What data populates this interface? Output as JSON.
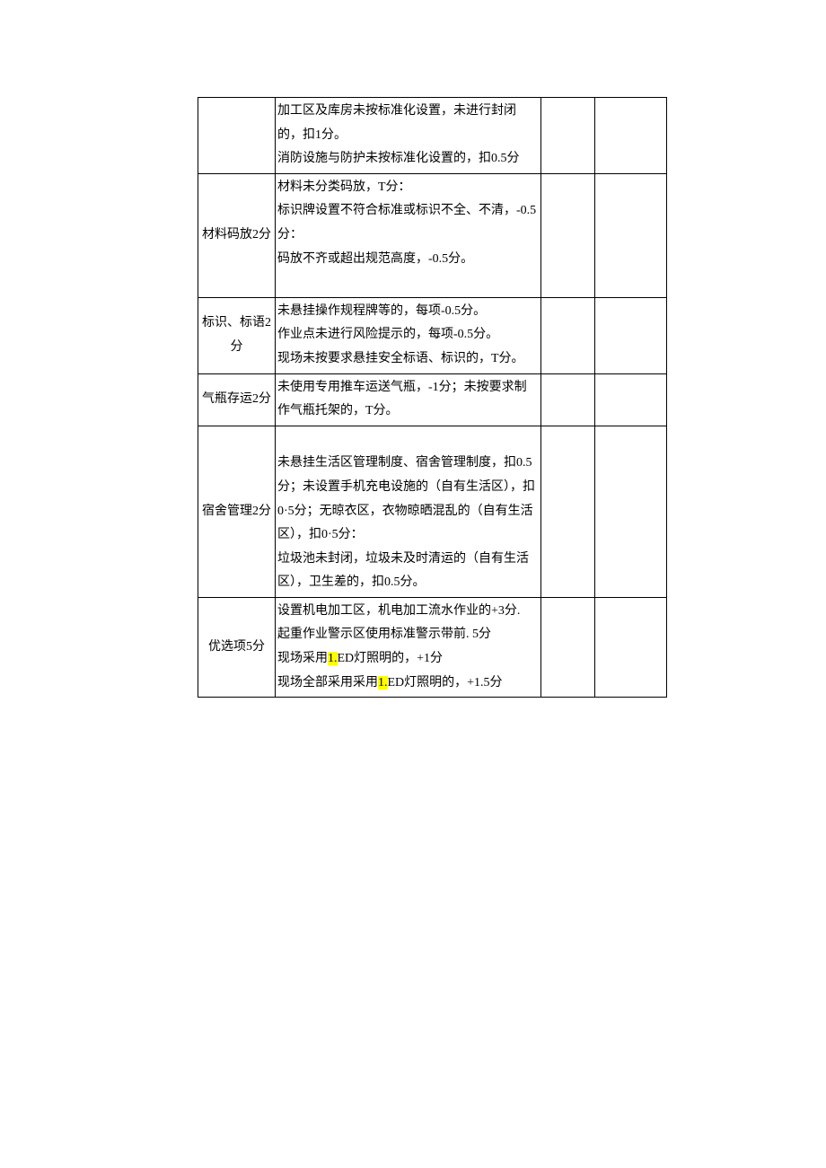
{
  "rows": [
    {
      "cat": "",
      "detail_lines": [
        {
          "segments": [
            {
              "t": "加工区及库房未按标准化设置，未进行封闭的，扣1分。"
            }
          ]
        },
        {
          "segments": [
            {
              "t": "消防设施与防护未按标准化设置的，扣0.5分"
            }
          ]
        }
      ]
    },
    {
      "cat": "材料码放2分",
      "detail_lines": [
        {
          "segments": [
            {
              "t": "材料未分类码放，T分："
            }
          ]
        },
        {
          "segments": [
            {
              "t": "标识牌设置不符合标准或标识不全、不清，-0.5分："
            }
          ]
        },
        {
          "segments": [
            {
              "t": "码放不齐或超出规范高度，-0.5分。"
            }
          ]
        },
        {
          "segments": [
            {
              "t": ""
            }
          ]
        }
      ]
    },
    {
      "cat": "标识、标语2分",
      "detail_lines": [
        {
          "segments": [
            {
              "t": "未悬挂操作规程牌等的，每项-0.5分。"
            }
          ]
        },
        {
          "segments": [
            {
              "t": "作业点未进行风险提示的，每项-0.5分。"
            }
          ]
        },
        {
          "segments": [
            {
              "t": "现场未按要求悬挂安全标语、标识的，T分。"
            }
          ]
        }
      ]
    },
    {
      "cat": "气瓶存运2分",
      "detail_lines": [
        {
          "segments": [
            {
              "t": "未使用专用推车运送气瓶，-1分；未按要求制作气瓶托架的，T分。"
            }
          ]
        }
      ]
    },
    {
      "cat": "宿舍管理2分",
      "detail_lines": [
        {
          "segments": [
            {
              "t": ""
            }
          ]
        },
        {
          "segments": [
            {
              "t": "未悬挂生活区管理制度、宿舍管理制度，扣0.5分；未设置手机充电设施的（自有生活区），扣0·5分；无晾衣区，衣物晾晒混乱的（自有生活区），扣0·5分："
            }
          ]
        },
        {
          "segments": [
            {
              "t": "垃圾池未封闭，垃圾未及时清运的（自有生活区），卫生差的，扣0.5分。"
            }
          ]
        }
      ]
    },
    {
      "cat": "优选项5分",
      "detail_lines": [
        {
          "segments": [
            {
              "t": "设置机电加工区，机电加工流水作业的+3分."
            }
          ]
        },
        {
          "segments": [
            {
              "t": "起重作业警示区使用标准警示带前. 5分"
            }
          ]
        },
        {
          "segments": [
            {
              "t": "现场采用"
            },
            {
              "t": "1.",
              "hl": true
            },
            {
              "t": "ED灯照明的，+1分"
            }
          ]
        },
        {
          "segments": [
            {
              "t": "现场全部采用采用"
            },
            {
              "t": "1.",
              "hl": true
            },
            {
              "t": "ED灯照明的，+1.5分"
            }
          ]
        }
      ]
    }
  ]
}
